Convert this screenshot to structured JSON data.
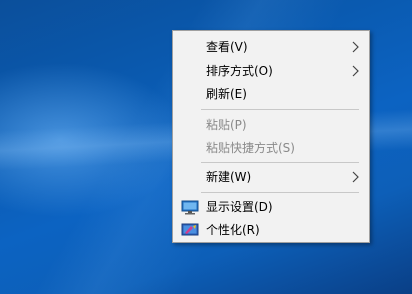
{
  "context_menu": {
    "items": [
      {
        "label": "查看(V)"
      },
      {
        "label": "排序方式(O)"
      },
      {
        "label": "刷新(E)"
      },
      {
        "label": "粘贴(P)"
      },
      {
        "label": "粘贴快捷方式(S)"
      },
      {
        "label": "新建(W)"
      },
      {
        "label": "显示设置(D)",
        "icon": "display-settings-icon"
      },
      {
        "label": "个性化(R)",
        "icon": "personalize-icon"
      }
    ]
  },
  "colors": {
    "menu_background": "#f2f2f2",
    "disabled_text": "#8a8a8a",
    "desktop_blue": "#0c63c2"
  }
}
